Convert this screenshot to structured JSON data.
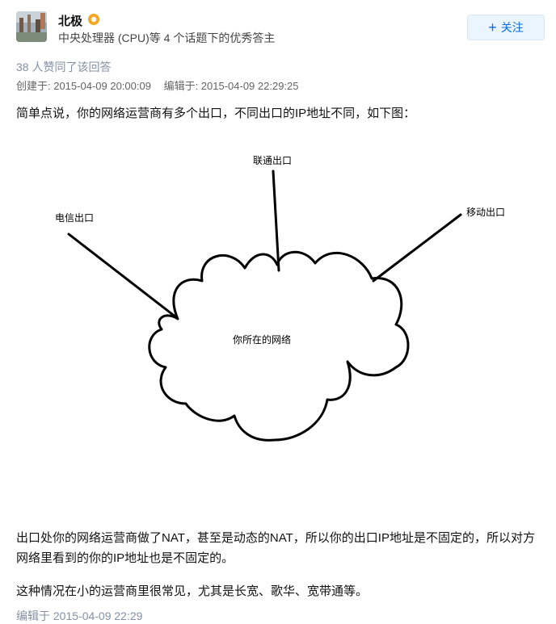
{
  "author": {
    "name": "北极",
    "bio": "中央处理器 (CPU)等 4 个话题下的优秀答主",
    "badge_color": "#f5a623"
  },
  "follow_button": {
    "label": "关注",
    "icon": "plus-icon",
    "color": "#056de8"
  },
  "meta": {
    "votes": "38 人赞同了该回答",
    "created": "创建于: 2015-04-09 20:00:09",
    "edited": "编辑于: 2015-04-09 22:29:25"
  },
  "content": {
    "intro": "简单点说，你的网络运营商有多个出口，不同出口的IP地址不同，如下图：",
    "diagram": {
      "label_telecom": "电信出口",
      "label_unicom": "联通出口",
      "label_mobile": "移动出口",
      "label_cloud": "你所在的网络"
    },
    "para2": "出口处你的网络运营商做了NAT，甚至是动态的NAT，所以你的出口IP地址是不固定的，所以对方网络里看到的你的IP地址也是不固定的。",
    "para3": "这种情况在小的运营商里很常见，尤其是长宽、歌华、宽带通等。"
  },
  "footer": {
    "edited": "编辑于 2015-04-09 22:29"
  }
}
